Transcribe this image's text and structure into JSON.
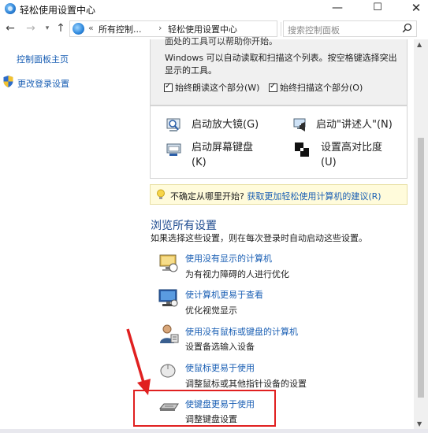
{
  "window": {
    "title": "轻松使用设置中心",
    "minimize_glyph": "—",
    "maximize_glyph": "☐",
    "close_glyph": "✕"
  },
  "address": {
    "crumbs": [
      "所有控制...",
      "轻松使用设置中心"
    ],
    "prefix": "«",
    "separator": "›",
    "search_placeholder": "搜索控制面板"
  },
  "left_nav": {
    "home": "控制面板主页",
    "change_login": "更改登录设置"
  },
  "top_panel": {
    "cut_text": "面处的工具可以帮助你开始。",
    "desc": "Windows 可以自动读取和扫描这个列表。按空格键选择突出显示的工具。",
    "checkbox1": "始终朗读这个部分(W)",
    "checkbox2": "始终扫描这个部分(O)"
  },
  "tools": [
    {
      "label": "启动放大镜(G)",
      "icon": "magnifier-icon"
    },
    {
      "label": "启动\"讲述人\"(N)",
      "icon": "narrator-icon"
    },
    {
      "label": "启动屏幕键盘",
      "label2": "(K)",
      "icon": "onscreen-keyboard-icon"
    },
    {
      "label": "设置高对比度",
      "label2": "(U)",
      "icon": "high-contrast-icon"
    }
  ],
  "tip": {
    "text": "不确定从哪里开始? ",
    "link": "获取更加轻松使用计算机的建议(R)"
  },
  "section": {
    "title": "浏览所有设置",
    "desc": "如果选择这些设置，则在每次登录时自动启动这些设置。"
  },
  "options": [
    {
      "title": "使用没有显示的计算机",
      "desc": "为有视力障碍的人进行优化",
      "icon": "no-display-icon"
    },
    {
      "title": "使计算机更易于查看",
      "desc": "优化视觉显示",
      "icon": "monitor-icon"
    },
    {
      "title": "使用没有鼠标或键盘的计算机",
      "desc": "设置备选输入设备",
      "icon": "user-input-icon"
    },
    {
      "title": "使鼠标更易于使用",
      "desc": "调整鼠标或其他指针设备的设置",
      "icon": "mouse-icon"
    },
    {
      "title": "使键盘更易于使用",
      "desc": "调整键盘设置",
      "icon": "keyboard-icon"
    }
  ],
  "colors": {
    "link": "#1a5fb4",
    "heading": "#1c4a8f",
    "highlight": "#e02020",
    "tip_bg": "#fffbdb"
  }
}
